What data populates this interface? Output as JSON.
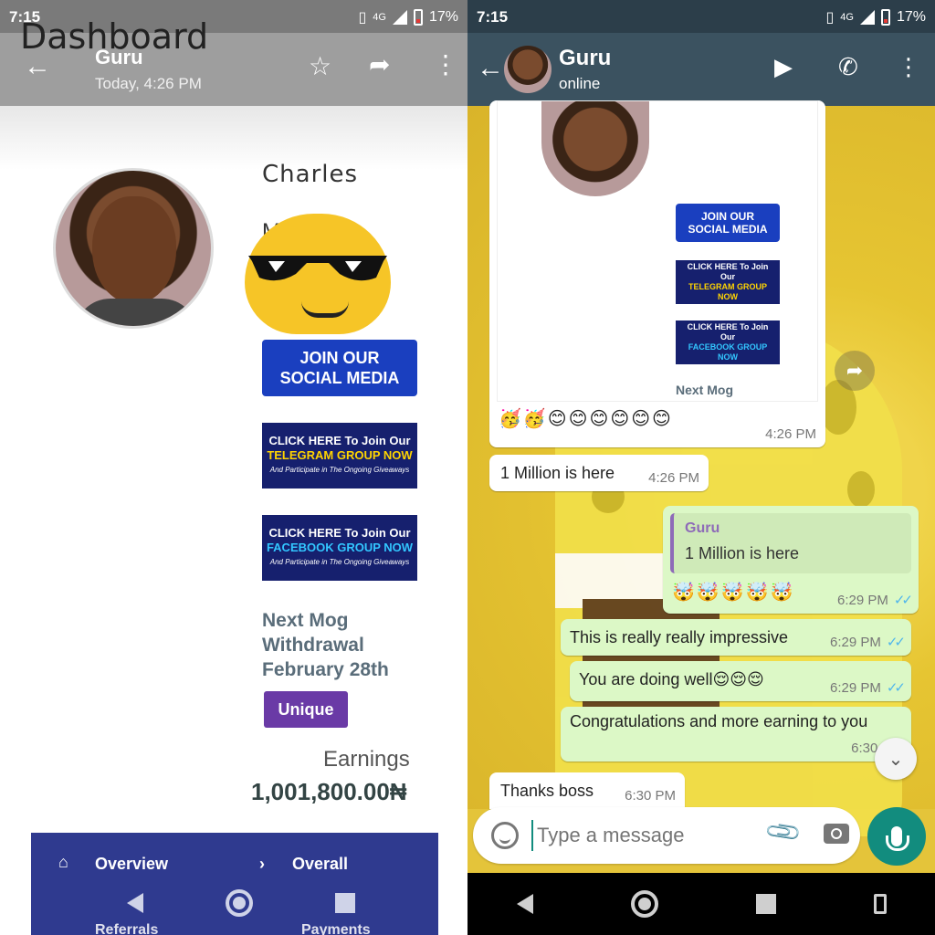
{
  "left": {
    "status": {
      "time": "7:15",
      "network": "4G",
      "battery": "17%"
    },
    "overlay_title": "Dashboard",
    "viewer": {
      "name": "Guru",
      "subtitle": "Today, 4:26 PM"
    },
    "profile": {
      "name": "Charles",
      "name_partial": "M"
    },
    "banners": {
      "social": [
        "JOIN OUR",
        "SOCIAL MEDIA"
      ],
      "telegram": {
        "line1": "CLICK HERE To Join Our",
        "line2": "TELEGRAM GROUP NOW",
        "line3": "And Participate in The Ongoing Giveaways"
      },
      "facebook": {
        "line1": "CLICK HERE To Join Our",
        "line2": "FACEBOOK GROUP NOW",
        "line3": "And Participate in The Ongoing Giveaways"
      }
    },
    "next_withdrawal": [
      "Next Mog",
      "Withdrawal",
      "February 28th"
    ],
    "badge": "Unique",
    "earnings_label": "Earnings",
    "earnings_value": "1,001,800.00₦",
    "nav": {
      "overview": "Overview",
      "overall": "Overall",
      "referrals": "Referrals",
      "payments": "Payments"
    }
  },
  "right": {
    "status": {
      "time": "7:15",
      "network": "4G",
      "battery": "17%"
    },
    "chat": {
      "name": "Guru",
      "presence": "online"
    },
    "image_message": {
      "caption_top": "Charles",
      "next_mog": "Next Mog",
      "emojis": "🥳🥳😊😊😊😊😊😊",
      "time": "4:26 PM"
    },
    "messages": [
      {
        "text": "1 Million is here",
        "time": "4:26 PM",
        "dir": "in"
      },
      {
        "quote_author": "Guru",
        "quote_text": "1 Million is here",
        "text": "🤯🤯🤯🤯🤯",
        "time": "6:29 PM",
        "dir": "out"
      },
      {
        "text": "This is really really impressive",
        "time": "6:29 PM",
        "dir": "out"
      },
      {
        "text": "You are doing well😌😌😌",
        "time": "6:29 PM",
        "dir": "out"
      },
      {
        "text": "Congratulations and more earning to you",
        "time": "6:30 PM",
        "dir": "out"
      },
      {
        "text": "Thanks boss",
        "time": "6:30 PM",
        "dir": "in"
      }
    ],
    "input": {
      "placeholder": "Type a message"
    }
  },
  "colors": {
    "whatsapp_green": "#128c7e",
    "out_bubble": "#dcf8c6",
    "banner_blue": "#1a3fbf",
    "unique_purple": "#6a3aa6"
  },
  "icons": [
    "back-arrow-icon",
    "star-icon",
    "forward-icon",
    "more-vert-icon",
    "video-call-icon",
    "phone-icon",
    "emoji-icon",
    "attach-icon",
    "camera-icon",
    "mic-icon",
    "home-icon",
    "chevron-right-icon"
  ]
}
